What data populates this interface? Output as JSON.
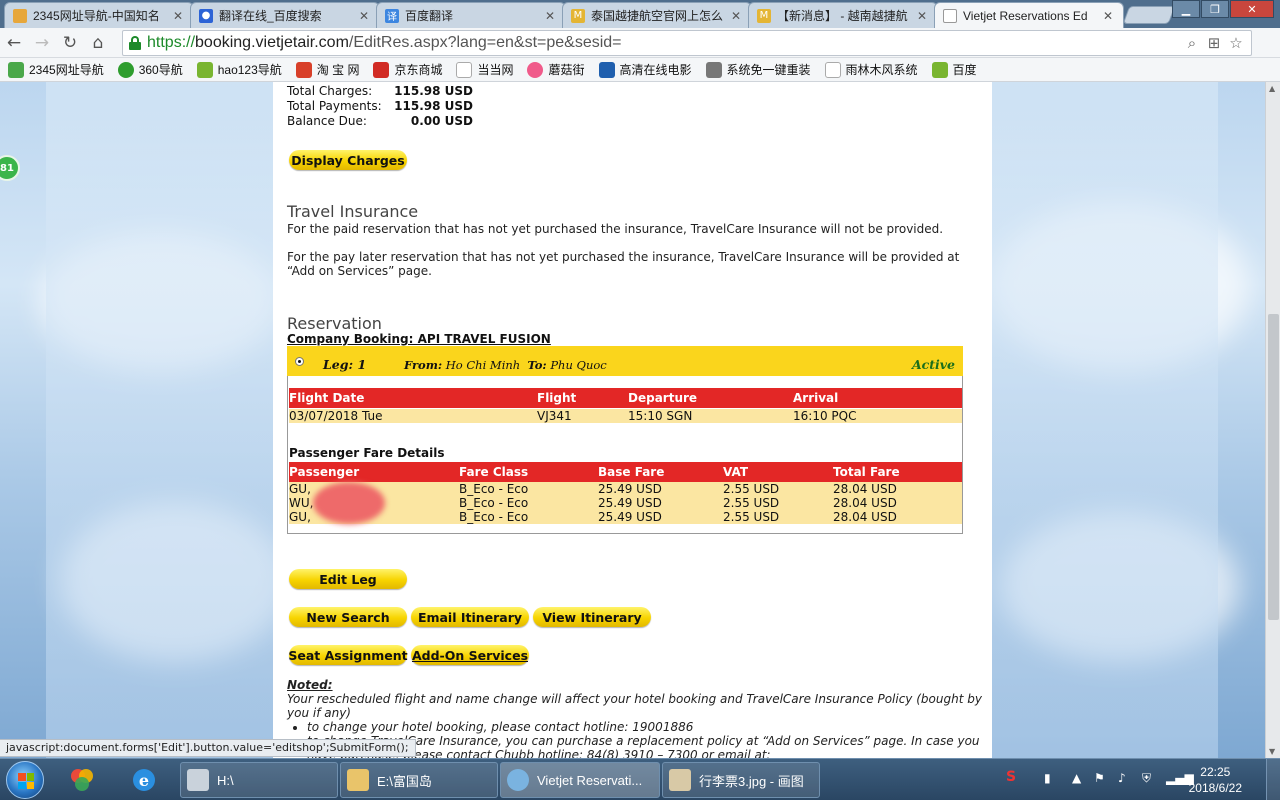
{
  "browser": {
    "tabs": [
      {
        "label": "2345网址导航-中国知名",
        "icon": "2345-icon",
        "color": "#e7a73b"
      },
      {
        "label": "翻译在线_百度搜索",
        "icon": "baidu-paw-icon",
        "color": "#2c63d6"
      },
      {
        "label": "百度翻译",
        "icon": "baidu-translate-icon",
        "color": "#3d86e0"
      },
      {
        "label": "泰国越捷航空官网上怎么",
        "icon": "mail-icon",
        "color": "#e4b534"
      },
      {
        "label": "【新消息】 - 越南越捷航",
        "icon": "mail-icon",
        "color": "#e4b534"
      },
      {
        "label": "Vietjet Reservations Ed",
        "icon": "page-icon",
        "color": "#ffffff"
      }
    ],
    "url_scheme": "https://",
    "url_host": "booking.vietjetair.com",
    "url_path": "/EditRes.aspx?lang=en&st=pe&sesid=",
    "bookmarks": [
      {
        "label": "2345网址导航",
        "color": "#4aa84a"
      },
      {
        "label": "360导航",
        "color": "#2e9d2e"
      },
      {
        "label": "hao123导航",
        "color": "#79b530"
      },
      {
        "label": "淘 宝 网",
        "color": "#d8402a"
      },
      {
        "label": "京东商城",
        "color": "#d12b24"
      },
      {
        "label": "当当网",
        "color": "#c9c9c9"
      },
      {
        "label": "蘑菇街",
        "color": "#f05a8a"
      },
      {
        "label": "高清在线电影",
        "color": "#1f5fae"
      },
      {
        "label": "系统免一键重装",
        "color": "#777777"
      },
      {
        "label": "雨林木风系统",
        "color": "#c9c9c9"
      },
      {
        "label": "百度",
        "color": "#79b530"
      }
    ],
    "badge": "81",
    "status_text": "javascript:document.forms['Edit'].button.value='editshop';SubmitForm();"
  },
  "totals": {
    "charges_label": "Total Charges:",
    "charges_value": "115.98 USD",
    "payments_label": "Total Payments:",
    "payments_value": "115.98 USD",
    "balance_label": "Balance Due:",
    "balance_value": "0.00 USD"
  },
  "buttons": {
    "display_charges": "Display Charges",
    "edit_leg": "Edit Leg",
    "new_search": "New Search",
    "email_itinerary": "Email Itinerary",
    "view_itinerary": "View Itinerary",
    "seat_assignment": "Seat Assignment",
    "add_on_services": "Add-On Services"
  },
  "insurance": {
    "title": "Travel Insurance",
    "para1": "For the paid reservation that has not yet purchased the insurance, TravelCare Insurance will not be provided.",
    "para2": "For the pay later reservation that has not yet purchased the insurance, TravelCare Insurance will be provided at “Add on Services” page."
  },
  "reservation": {
    "title": "Reservation",
    "company": "Company Booking: API TRAVEL FUSION",
    "leg_label": "Leg: 1",
    "from_label": "From:",
    "from": "Ho Chi Minh",
    "to_label": "To:",
    "to": "Phu Quoc",
    "status": "Active",
    "flight_headers": {
      "date": "Flight Date",
      "flight": "Flight",
      "departure": "Departure",
      "arrival": "Arrival"
    },
    "flight_row": {
      "date": "03/07/2018 Tue",
      "flight": "VJ341",
      "departure": "15:10 SGN",
      "arrival": "16:10 PQC"
    },
    "fare_title": "Passenger Fare Details",
    "fare_headers": {
      "passenger": "Passenger",
      "fare_class": "Fare Class",
      "base": "Base Fare",
      "vat": "VAT",
      "total": "Total Fare"
    },
    "passengers": [
      {
        "name": "GU,",
        "fare_class": "B_Eco - Eco",
        "base": "25.49 USD",
        "vat": "2.55 USD",
        "total": "28.04 USD"
      },
      {
        "name": "WU,",
        "fare_class": "B_Eco - Eco",
        "base": "25.49 USD",
        "vat": "2.55 USD",
        "total": "28.04 USD"
      },
      {
        "name": "GU,",
        "fare_class": "B_Eco - Eco",
        "base": "25.49 USD",
        "vat": "2.55 USD",
        "total": "28.04 USD"
      }
    ]
  },
  "noted": {
    "title": "Noted:",
    "line1": "Your rescheduled flight and name change will affect your hotel booking and TravelCare Insurance Policy (bought by you if any)",
    "bullet1": "to change your hotel booking, please contact hotline: 19001886",
    "bullet2": "to change TravelCare Insurance, you can purchase a replacement policy at “Add on Services” page. In case you have purchase, please contact Chubb hotline: 84(8) 3910 – 7300 or email at:"
  },
  "taskbar": {
    "tasks": [
      "H:\\",
      "E:\\富国岛",
      "Vietjet Reservati...",
      "行李票3.jpg - 画图"
    ],
    "time": "22:25",
    "date": "2018/6/22"
  }
}
